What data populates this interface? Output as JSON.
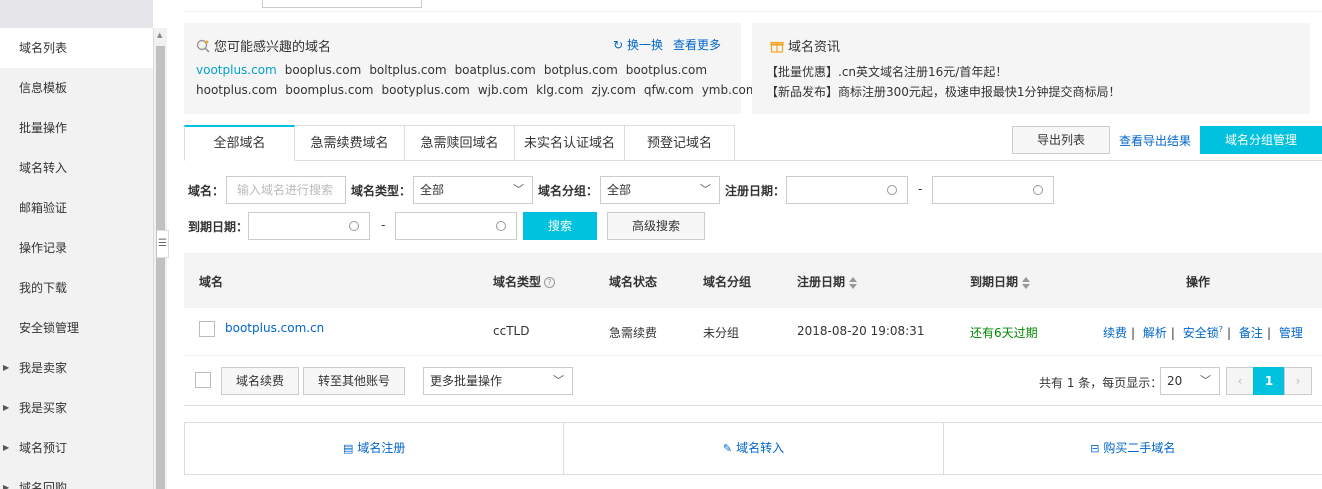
{
  "sidebar": {
    "items": [
      {
        "label": "域名列表"
      },
      {
        "label": "信息模板"
      },
      {
        "label": "批量操作"
      },
      {
        "label": "域名转入"
      },
      {
        "label": "邮箱验证"
      },
      {
        "label": "操作记录"
      },
      {
        "label": "我的下载"
      },
      {
        "label": "安全锁管理"
      },
      {
        "label": "我是卖家"
      },
      {
        "label": "我是买家"
      },
      {
        "label": "域名预订"
      },
      {
        "label": "域名回购"
      }
    ]
  },
  "suggest": {
    "title": "您可能感兴趣的域名",
    "refresh": "换一换",
    "more": "查看更多",
    "row1": [
      "vootplus.com",
      "booplus.com",
      "boltplus.com",
      "boatplus.com",
      "botplus.com",
      "bootplus.com"
    ],
    "row2": [
      "hootplus.com",
      "boomplus.com",
      "bootyplus.com",
      "wjb.com",
      "klg.com",
      "zjy.com",
      "qfw.com",
      "ymb.com"
    ]
  },
  "news": {
    "title": "域名资讯",
    "items": [
      "【批量优惠】.cn英文域名注册16元/首年起！",
      "【新品发布】商标注册300元起，极速申报最快1分钟提交商标局！"
    ]
  },
  "tabs": [
    "全部域名",
    "急需续费域名",
    "急需赎回域名",
    "未实名认证域名",
    "预登记域名"
  ],
  "actions": {
    "export": "导出列表",
    "export_result": "查看导出结果",
    "group_manage": "域名分组管理"
  },
  "filters": {
    "domain_label": "域名：",
    "domain_placeholder": "输入域名进行搜索",
    "type_label": "域名类型：",
    "type_value": "全部",
    "group_label": "域名分组：",
    "group_value": "全部",
    "reg_label": "注册日期：",
    "exp_label": "到期日期：",
    "dash": "-",
    "search": "搜索",
    "advanced": "高级搜索"
  },
  "table": {
    "headers": [
      "域名",
      "域名类型",
      "域名状态",
      "域名分组",
      "注册日期",
      "到期日期",
      "操作"
    ],
    "rows": [
      {
        "domain": "bootplus.com.cn",
        "type": "ccTLD",
        "status": "急需续费",
        "group": "未分组",
        "reg_date": "2018-08-20 19:08:31",
        "exp": "还有6天过期",
        "ops": [
          "续费",
          "解析",
          "安全锁",
          "备注",
          "管理"
        ]
      }
    ]
  },
  "batch": {
    "renew": "域名续费",
    "transfer": "转至其他账号",
    "more": "更多批量操作",
    "total_text": "共有 1 条，每页显示：",
    "page_size": "20",
    "current_page": "1",
    "prev": "‹",
    "next": "›"
  },
  "bottom": {
    "register": "域名注册",
    "transfer_in": "域名转入",
    "buy": "购买二手域名"
  },
  "colors": {
    "accent": "#00c1de",
    "link": "#0066cc",
    "success": "#008800"
  }
}
